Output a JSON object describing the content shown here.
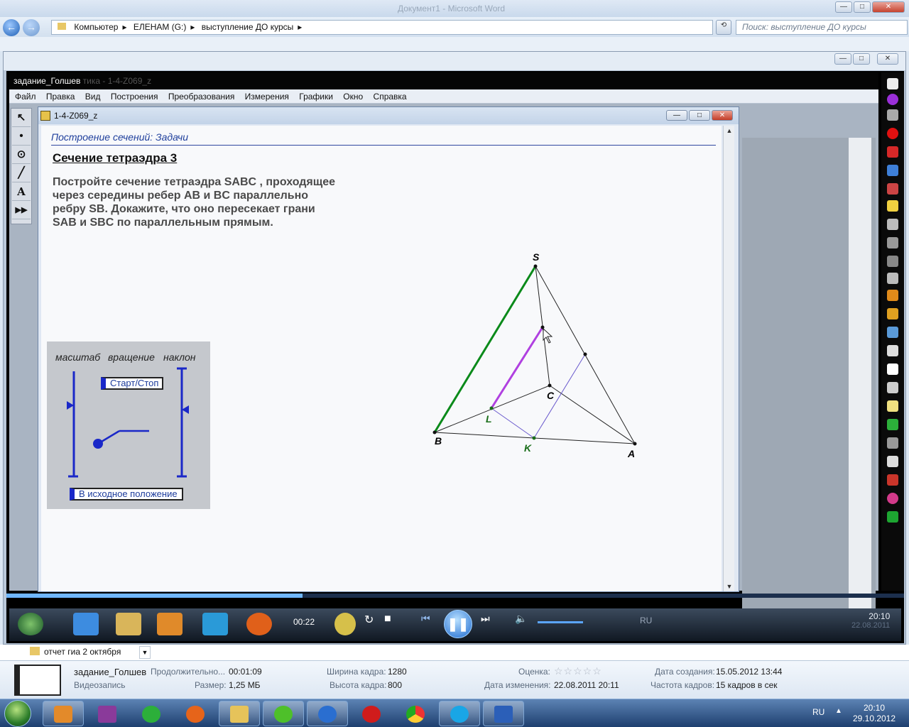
{
  "explorer": {
    "blurred_title": "Документ1 - Microsoft Word",
    "breadcrumb": [
      "Компьютер",
      "ЕЛЕНАМ (G:)",
      "выступление ДО курсы"
    ],
    "search_placeholder": "Поиск: выступление ДО курсы",
    "file_row_name": "отчет гиа 2 октября"
  },
  "app": {
    "title": "задание_Голшев",
    "title_faded": "тика - 1-4-Z069_z",
    "menu": [
      "Файл",
      "Правка",
      "Вид",
      "Построения",
      "Преобразования",
      "Измерения",
      "Графики",
      "Окно",
      "Справка"
    ],
    "tools": [
      "arrow-tool-icon",
      "point-tool-icon",
      "compass-tool-icon",
      "segment-tool-icon",
      "text-tool-icon",
      "custom-tool-icon"
    ],
    "tool_glyphs": [
      "↖",
      "•",
      "⊙",
      "╱",
      "A",
      "▶▶"
    ]
  },
  "doc": {
    "title": "1-4-Z069_z",
    "section_header": "Построение сечений: Задачи",
    "task_title": "Сечение тетраэдра 3",
    "task_text": "Постройте сечение тетраэдра SABC , проходящее через середины ребер AB и BC параллельно ребру SB. Докажите, что оно пересекает грани SAB и SBC по параллельным прямым.",
    "controls": {
      "scale_label": "масштаб",
      "rotate_label": "вращение",
      "tilt_label": "наклон",
      "start_stop": "Старт/Стоп",
      "reset": "В исходное положение"
    },
    "points": {
      "S": "S",
      "A": "A",
      "B": "B",
      "C": "C",
      "K": "K",
      "L": "L"
    },
    "colors": {
      "edge_sb": "#0a8a1a",
      "section_line": "#b040e0",
      "section_thin": "#6a5acd",
      "point_label_green": "#1a6e1a"
    }
  },
  "player": {
    "time": "00:22",
    "progress": 0.33,
    "lang": "RU",
    "clock_time": "20:10",
    "clock_date": "22.08.2011"
  },
  "details": {
    "name": "задание_Голшев",
    "type": "Видеозапись",
    "duration_label": "Продолжительно...",
    "duration": "00:01:09",
    "size_label": "Размер:",
    "size": "1,25 МБ",
    "width_label": "Ширина кадра:",
    "width": "1280",
    "height_label": "Высота кадра:",
    "height": "800",
    "rating_label": "Оценка:",
    "rating": "☆☆☆☆☆",
    "modified_label": "Дата изменения:",
    "modified": "22.08.2011 20:11",
    "created_label": "Дата создания:",
    "created": "15.05.2012 13:44",
    "fps_label": "Частота кадров:",
    "fps": "15 кадров в сек"
  },
  "taskbar": {
    "lang": "RU",
    "time": "20:10",
    "date": "29.10.2012",
    "apps": [
      "media-player-icon",
      "save-icon",
      "clover-icon",
      "firefox-icon",
      "explorer-icon",
      "icq-icon",
      "download-icon",
      "opera-icon",
      "chrome-icon",
      "skype-icon",
      "word-icon"
    ]
  }
}
